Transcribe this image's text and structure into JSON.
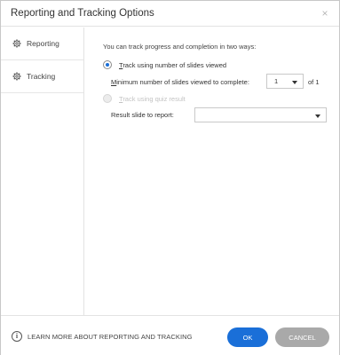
{
  "window": {
    "title": "Reporting and Tracking Options",
    "close_glyph": "×"
  },
  "sidebar": {
    "items": [
      {
        "label": "Reporting",
        "icon": "gear-icon",
        "selected": false
      },
      {
        "label": "Tracking",
        "icon": "gear-icon",
        "selected": true
      }
    ]
  },
  "tracking": {
    "intro": "You can track progress and completion in two ways:",
    "option_slides": {
      "label": "Track using number of slides viewed",
      "checked": true,
      "enabled": true
    },
    "min_slides_label": "Minimum number of slides viewed to complete:",
    "min_slides_value": "1",
    "min_slides_of": "of 1",
    "option_quiz": {
      "label": "Track using quiz result",
      "checked": false,
      "enabled": false
    },
    "result_slide_label": "Result slide to report:",
    "result_slide_value": ""
  },
  "footer": {
    "learn_more": "LEARN MORE ABOUT REPORTING AND TRACKING",
    "ok_label": "OK",
    "cancel_label": "CANCEL"
  },
  "colors": {
    "accent": "#1a6fd8",
    "cancel_bg": "#a9a9a9",
    "disabled_text": "#c3c3c3"
  }
}
